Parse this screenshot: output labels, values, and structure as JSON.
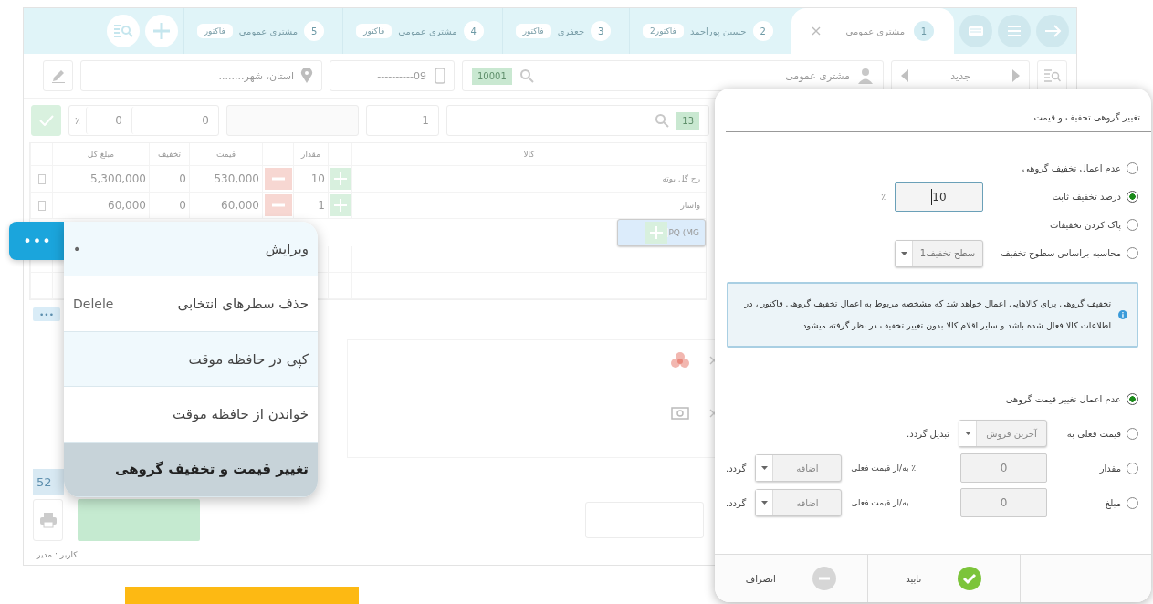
{
  "app": {
    "tabs": [
      {
        "number": "1",
        "label": "مشتری عمومی",
        "selected": true,
        "closable": true
      },
      {
        "number": "2",
        "label": "حسین پوراحمد",
        "badge": "فاکتور2",
        "selected": false,
        "closable": false
      },
      {
        "number": "3",
        "label": "جعفری",
        "badge": "فاکتور",
        "selected": false,
        "closable": false
      },
      {
        "number": "4",
        "label": "مشتری عمومی",
        "badge": "فاکتور",
        "selected": false,
        "closable": false
      },
      {
        "number": "5",
        "label": "مشتری عمومی",
        "badge": "فاکتور",
        "selected": false,
        "closable": false
      }
    ],
    "customer": {
      "name": "مشتری عمومی",
      "nav_label": "جدید",
      "code": "10001",
      "phone_placeholder": "09----------",
      "address_placeholder": "استان، شهر........"
    },
    "entry": {
      "code": "13",
      "quantity": "1",
      "amount": "0",
      "percent": "0",
      "percent_sign": "٪"
    },
    "table": {
      "columns": [
        "کالا",
        "مقدار",
        "قیمت",
        "تخفیف",
        "مبلغ کل"
      ],
      "rows": [
        {
          "name": "رح گل بوته",
          "quantity": "10",
          "price": "530,000",
          "discount": "0",
          "total": "5,300,000",
          "selected": false
        },
        {
          "name": "واسار",
          "quantity": "1",
          "price": "60,000",
          "discount": "0",
          "total": "60,000",
          "selected": false
        },
        {
          "name": "PQ (MG",
          "selected": true
        }
      ]
    },
    "more_button": "•••",
    "total_tile": "52",
    "footer": "کاربر : مدیر"
  },
  "context_menu": {
    "toggle": "•••",
    "items": [
      {
        "label": "ویرایش",
        "shortcut": "•",
        "selected": false
      },
      {
        "label": "حذف سطرهای انتخابی",
        "shortcut": "Delele",
        "selected": false
      },
      {
        "label": "کپی در حافظه موقت",
        "selected": false
      },
      {
        "label": "خواندن از حافظه موقت",
        "selected": false
      },
      {
        "label": "تغییر قیمت و تخفیف گروهی",
        "selected": true
      }
    ]
  },
  "dialog": {
    "title": "تغییر گروهی تخفیف و قیمت",
    "discount_options": [
      {
        "kind": "plain",
        "label": "عدم اعمال تخفیف گروهی",
        "selected": false
      },
      {
        "kind": "input",
        "label": "درصد تخفیف ثابت",
        "selected": true,
        "value": "10",
        "unit": "٪"
      },
      {
        "kind": "plain",
        "label": "پاک کردن تخفیفات",
        "selected": false
      },
      {
        "kind": "select",
        "label": "محاسبه براساس سطوح تخفیف",
        "selected": false,
        "select": "سطح تخفیف1"
      }
    ],
    "info": "تخفیف گروهی برای کالاهایی اعمال خواهد شد که مشخصه مربوط به اعمال تخفیف گروهی فاکتور ، در اطلاعات کالا فعال شده باشد و سایر اقلام کالا بدون تغییر تخفیف در نظر گرفته میشود",
    "price_options": [
      {
        "kind": "plain",
        "label": "عدم اعمال تغییر قیمت گروهی",
        "selected": true
      },
      {
        "kind": "convert",
        "label": "قیمت فعلی به",
        "selected": false,
        "select": "آخرین فروش",
        "suffix": "تبدیل گردد."
      },
      {
        "kind": "adjust",
        "label": "مقدار",
        "selected": false,
        "value": "0",
        "middle": "٪ به/از قیمت فعلی",
        "select": "اضافه",
        "suffix": "گردد."
      },
      {
        "kind": "adjust",
        "label": "مبلغ",
        "selected": false,
        "value": "0",
        "middle": "به/از قیمت فعلی",
        "select": "اضافه",
        "suffix": "گردد."
      }
    ],
    "buttons": [
      {
        "kind": "confirm",
        "label": "تایید"
      },
      {
        "kind": "cancel",
        "label": "انصراف"
      }
    ]
  }
}
